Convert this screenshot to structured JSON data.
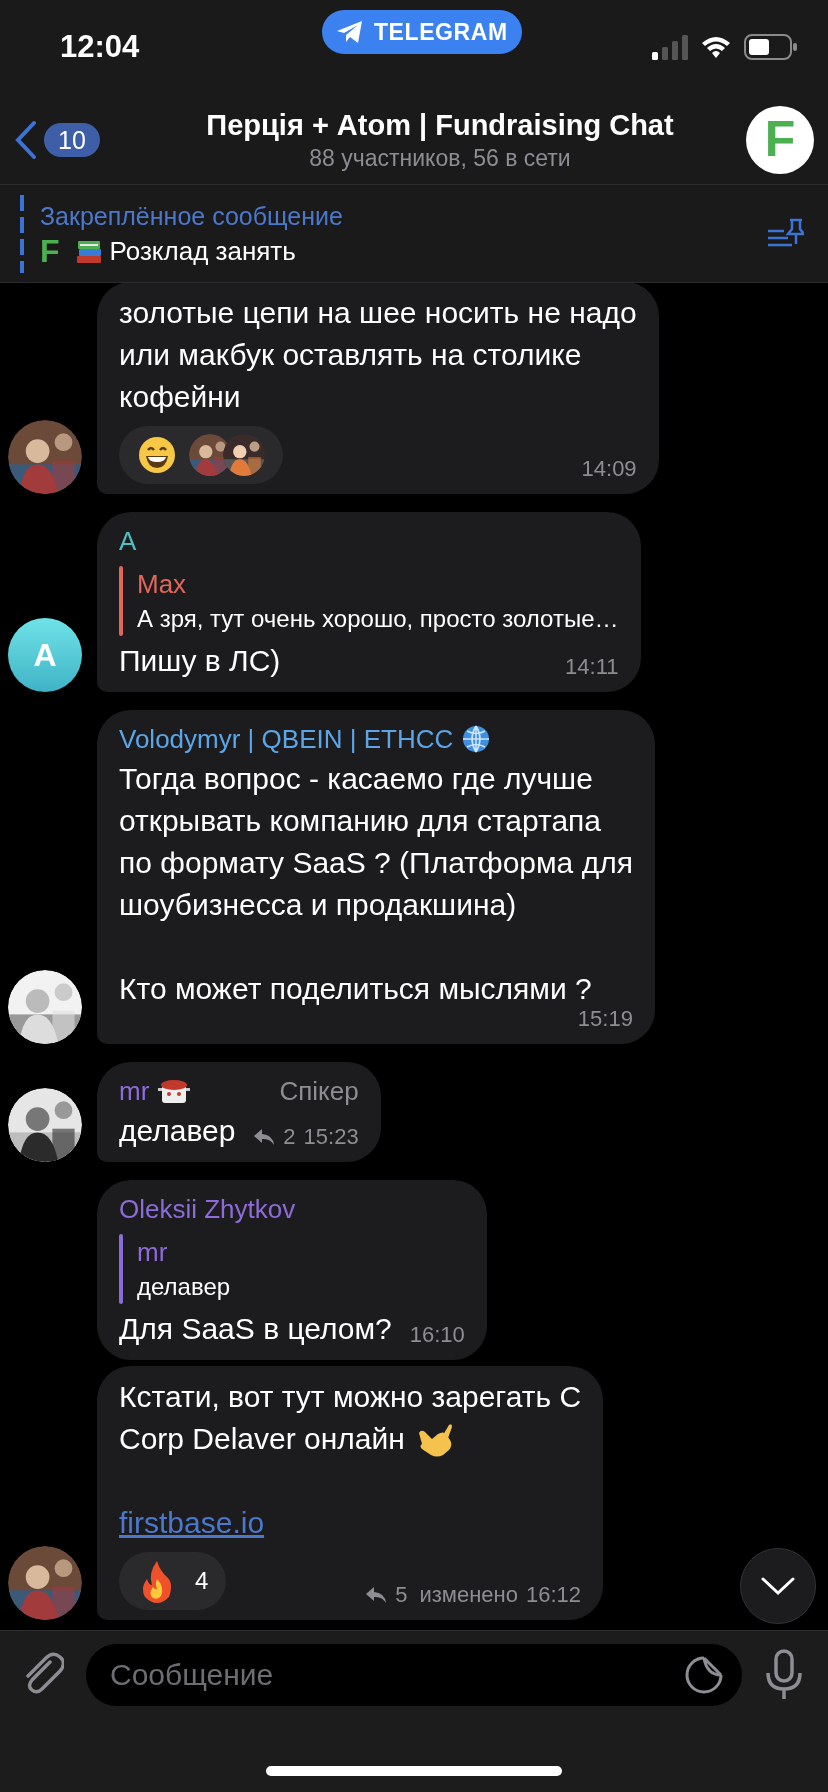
{
  "status_bar": {
    "time": "12:04",
    "app_badge": "TELEGRAM"
  },
  "header": {
    "back_count": "10",
    "title": "Перція + Atom | Fundraising Chat",
    "subtitle": "88 участников, 56 в сети",
    "avatar_letter": "F"
  },
  "pinned": {
    "label": "Закреплённое сообщение",
    "icon_letter": "F",
    "emoji": {
      "kind": "books"
    },
    "text": "Розклад занять"
  },
  "messages": [
    {
      "avatar": {
        "kind": "picture"
      },
      "text": "золотые цепи на шее носить не надо\nили макбук оставлять на столике\nкофейни",
      "reactions": [
        {
          "kind": "grin",
          "reactors": [
            {
              "kind": "picture"
            },
            {
              "kind": "picture"
            }
          ]
        }
      ],
      "time": "14:09"
    },
    {
      "avatar": {
        "kind": "letter",
        "letter": "A"
      },
      "sender": "A",
      "color": "#4fbfbf",
      "reply": {
        "name": "Max",
        "color": "#e0675a",
        "text": "А зря, тут очень хорошо, просто золотые…"
      },
      "text": "Пишу в ЛС)",
      "time": "14:11"
    },
    {
      "avatar": {
        "kind": "picture"
      },
      "sender": "Volodymyr | QBEIN | ETHCC",
      "sender_emoji": {
        "kind": "globe"
      },
      "color": "#5ca6e8",
      "text": "Тогда вопрос - касаемо где лучше\nоткрывать компанию для стартапа\nпо формату SaaS ? (Платформа для\nшоубизнесса и продакшина)\n\nКто может поделиться мыслями ?",
      "time": "15:19"
    },
    {
      "avatar": {
        "kind": "picture"
      },
      "sender": "mr",
      "sender_emoji": {
        "kind": "pot"
      },
      "color": "#8d6bd8",
      "role": "Спікер",
      "text": "делавер",
      "replies": "2",
      "time": "15:23"
    },
    {
      "sender": "Oleksii Zhytkov",
      "color": "#8d6bd8",
      "reply": {
        "name": "mr",
        "color": "#8d6bd8",
        "text": "делавер"
      },
      "text": "Для SaaS в целом?",
      "time": "16:10"
    },
    {
      "avatar": {
        "kind": "picture"
      },
      "text": "Кстати, вот тут можно зарегать С\nCorp Delaver онлайн",
      "text_emoji": {
        "kind": "hand"
      },
      "link": "firstbase.io",
      "reactions": [
        {
          "kind": "fire",
          "count": "4"
        }
      ],
      "replies": "5",
      "edited": "изменено",
      "time": "16:12"
    }
  ],
  "input": {
    "placeholder": "Сообщение"
  }
}
